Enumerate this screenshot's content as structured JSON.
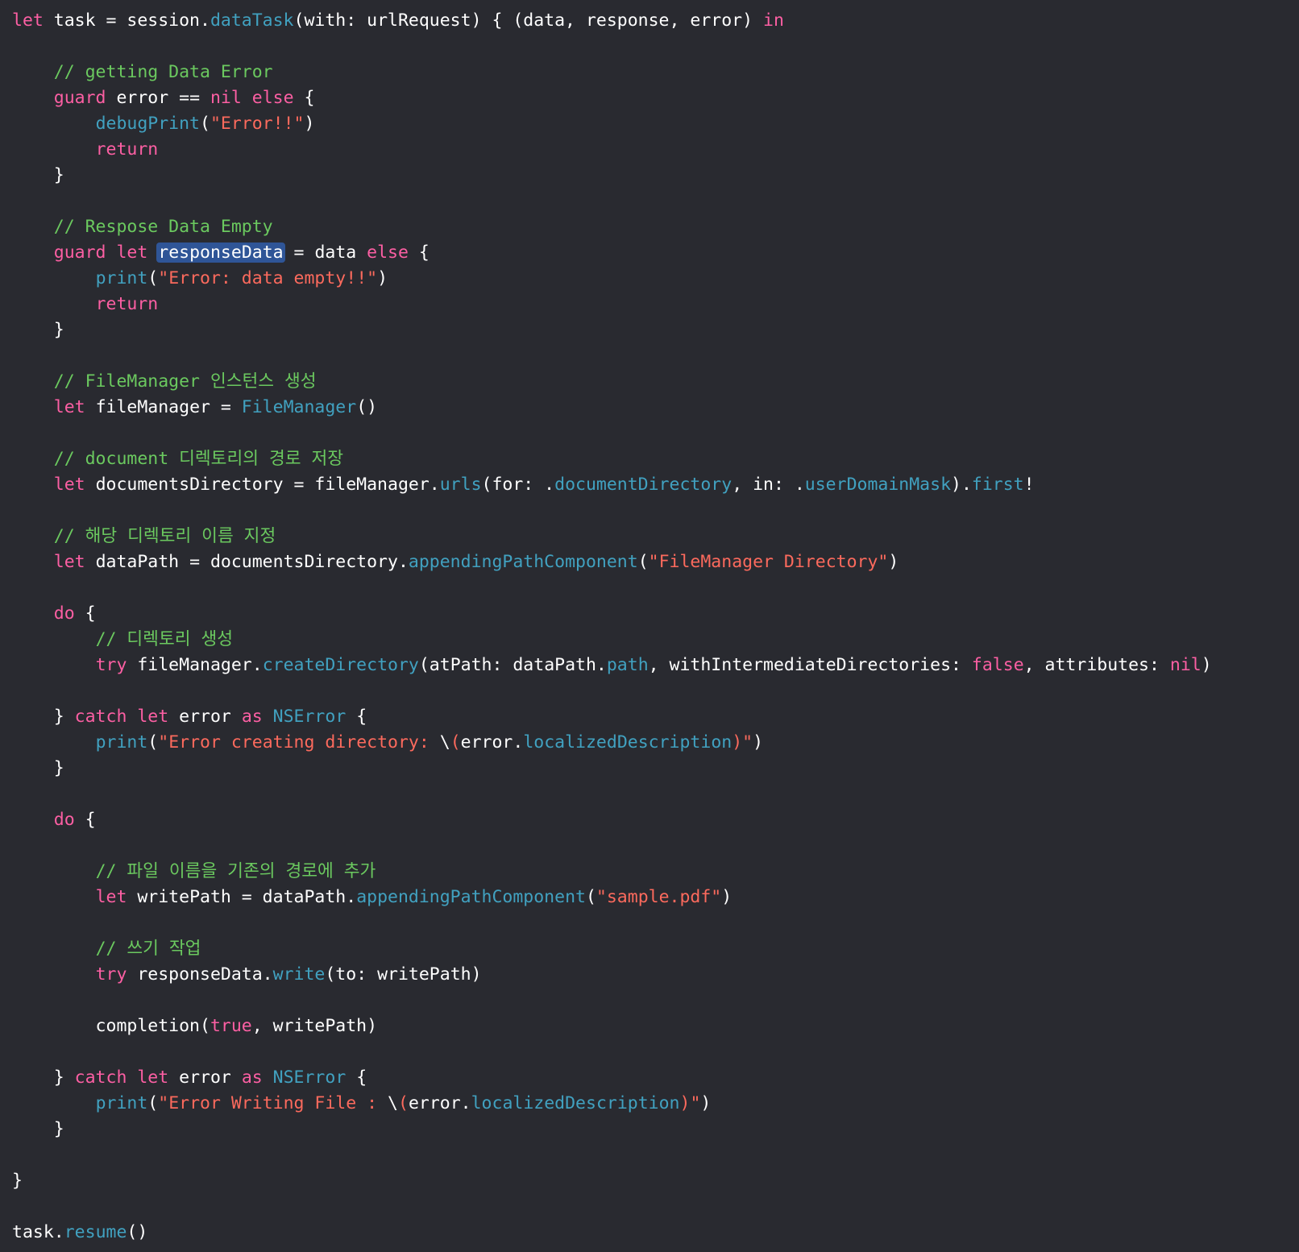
{
  "editor": {
    "theme_colors": {
      "background": "#292a30",
      "plain": "#ffffff",
      "keyword": "#fc5fa3",
      "comment": "#6bc95f",
      "string": "#fc6a5d",
      "function": "#41a1c0",
      "selection": "#2f5597"
    },
    "selected_token": "responseData",
    "lines": [
      [
        {
          "t": "kw",
          "v": "let"
        },
        {
          "t": "plain",
          "v": " task = session."
        },
        {
          "t": "fn",
          "v": "dataTask"
        },
        {
          "t": "plain",
          "v": "(with: urlRequest) { (data, response, error) "
        },
        {
          "t": "kw",
          "v": "in"
        }
      ],
      [],
      [
        {
          "t": "plain",
          "v": "    "
        },
        {
          "t": "com",
          "v": "// getting Data Error"
        }
      ],
      [
        {
          "t": "plain",
          "v": "    "
        },
        {
          "t": "kw",
          "v": "guard"
        },
        {
          "t": "plain",
          "v": " error == "
        },
        {
          "t": "kw",
          "v": "nil"
        },
        {
          "t": "plain",
          "v": " "
        },
        {
          "t": "kw",
          "v": "else"
        },
        {
          "t": "plain",
          "v": " {"
        }
      ],
      [
        {
          "t": "plain",
          "v": "        "
        },
        {
          "t": "fn",
          "v": "debugPrint"
        },
        {
          "t": "plain",
          "v": "("
        },
        {
          "t": "str",
          "v": "\"Error!!\""
        },
        {
          "t": "plain",
          "v": ")"
        }
      ],
      [
        {
          "t": "plain",
          "v": "        "
        },
        {
          "t": "kw",
          "v": "return"
        }
      ],
      [
        {
          "t": "plain",
          "v": "    }"
        }
      ],
      [],
      [
        {
          "t": "plain",
          "v": "    "
        },
        {
          "t": "com",
          "v": "// Respose Data Empty"
        }
      ],
      [
        {
          "t": "plain",
          "v": "    "
        },
        {
          "t": "kw",
          "v": "guard"
        },
        {
          "t": "plain",
          "v": " "
        },
        {
          "t": "kw",
          "v": "let"
        },
        {
          "t": "plain",
          "v": " "
        },
        {
          "t": "sel",
          "v": "responseData"
        },
        {
          "t": "plain",
          "v": " = data "
        },
        {
          "t": "kw",
          "v": "else"
        },
        {
          "t": "plain",
          "v": " {"
        }
      ],
      [
        {
          "t": "plain",
          "v": "        "
        },
        {
          "t": "fn",
          "v": "print"
        },
        {
          "t": "plain",
          "v": "("
        },
        {
          "t": "str",
          "v": "\"Error: data empty!!\""
        },
        {
          "t": "plain",
          "v": ")"
        }
      ],
      [
        {
          "t": "plain",
          "v": "        "
        },
        {
          "t": "kw",
          "v": "return"
        }
      ],
      [
        {
          "t": "plain",
          "v": "    }"
        }
      ],
      [],
      [
        {
          "t": "plain",
          "v": "    "
        },
        {
          "t": "com",
          "v": "// FileManager 인스턴스 생성"
        }
      ],
      [
        {
          "t": "plain",
          "v": "    "
        },
        {
          "t": "kw",
          "v": "let"
        },
        {
          "t": "plain",
          "v": " fileManager = "
        },
        {
          "t": "fn",
          "v": "FileManager"
        },
        {
          "t": "plain",
          "v": "()"
        }
      ],
      [],
      [
        {
          "t": "plain",
          "v": "    "
        },
        {
          "t": "com",
          "v": "// document 디렉토리의 경로 저장"
        }
      ],
      [
        {
          "t": "plain",
          "v": "    "
        },
        {
          "t": "kw",
          "v": "let"
        },
        {
          "t": "plain",
          "v": " documentsDirectory = fileManager."
        },
        {
          "t": "fn",
          "v": "urls"
        },
        {
          "t": "plain",
          "v": "(for: ."
        },
        {
          "t": "fn",
          "v": "documentDirectory"
        },
        {
          "t": "plain",
          "v": ", in: ."
        },
        {
          "t": "fn",
          "v": "userDomainMask"
        },
        {
          "t": "plain",
          "v": ")."
        },
        {
          "t": "fn",
          "v": "first"
        },
        {
          "t": "plain",
          "v": "!"
        }
      ],
      [],
      [
        {
          "t": "plain",
          "v": "    "
        },
        {
          "t": "com",
          "v": "// 해당 디렉토리 이름 지정"
        }
      ],
      [
        {
          "t": "plain",
          "v": "    "
        },
        {
          "t": "kw",
          "v": "let"
        },
        {
          "t": "plain",
          "v": " dataPath = documentsDirectory."
        },
        {
          "t": "fn",
          "v": "appendingPathComponent"
        },
        {
          "t": "plain",
          "v": "("
        },
        {
          "t": "str",
          "v": "\"FileManager Directory\""
        },
        {
          "t": "plain",
          "v": ")"
        }
      ],
      [],
      [
        {
          "t": "plain",
          "v": "    "
        },
        {
          "t": "kw",
          "v": "do"
        },
        {
          "t": "plain",
          "v": " {"
        }
      ],
      [
        {
          "t": "plain",
          "v": "        "
        },
        {
          "t": "com",
          "v": "// 디렉토리 생성"
        }
      ],
      [
        {
          "t": "plain",
          "v": "        "
        },
        {
          "t": "kw",
          "v": "try"
        },
        {
          "t": "plain",
          "v": " fileManager."
        },
        {
          "t": "fn",
          "v": "createDirectory"
        },
        {
          "t": "plain",
          "v": "(atPath: dataPath."
        },
        {
          "t": "fn",
          "v": "path"
        },
        {
          "t": "plain",
          "v": ", withIntermediateDirectories: "
        },
        {
          "t": "kw",
          "v": "false"
        },
        {
          "t": "plain",
          "v": ", attributes: "
        },
        {
          "t": "kw",
          "v": "nil"
        },
        {
          "t": "plain",
          "v": ")"
        }
      ],
      [],
      [
        {
          "t": "plain",
          "v": "    } "
        },
        {
          "t": "kw",
          "v": "catch"
        },
        {
          "t": "plain",
          "v": " "
        },
        {
          "t": "kw",
          "v": "let"
        },
        {
          "t": "plain",
          "v": " error "
        },
        {
          "t": "kw",
          "v": "as"
        },
        {
          "t": "plain",
          "v": " "
        },
        {
          "t": "fn",
          "v": "NSError"
        },
        {
          "t": "plain",
          "v": " {"
        }
      ],
      [
        {
          "t": "plain",
          "v": "        "
        },
        {
          "t": "fn",
          "v": "print"
        },
        {
          "t": "plain",
          "v": "("
        },
        {
          "t": "str",
          "v": "\"Error creating directory: "
        },
        {
          "t": "plain",
          "v": "\\"
        },
        {
          "t": "str",
          "v": "("
        },
        {
          "t": "plain",
          "v": "error."
        },
        {
          "t": "fn",
          "v": "localizedDescription"
        },
        {
          "t": "str",
          "v": ")\""
        },
        {
          "t": "plain",
          "v": ")"
        }
      ],
      [
        {
          "t": "plain",
          "v": "    }"
        }
      ],
      [],
      [
        {
          "t": "plain",
          "v": "    "
        },
        {
          "t": "kw",
          "v": "do"
        },
        {
          "t": "plain",
          "v": " {"
        }
      ],
      [],
      [
        {
          "t": "plain",
          "v": "        "
        },
        {
          "t": "com",
          "v": "// 파일 이름을 기존의 경로에 추가"
        }
      ],
      [
        {
          "t": "plain",
          "v": "        "
        },
        {
          "t": "kw",
          "v": "let"
        },
        {
          "t": "plain",
          "v": " writePath = dataPath."
        },
        {
          "t": "fn",
          "v": "appendingPathComponent"
        },
        {
          "t": "plain",
          "v": "("
        },
        {
          "t": "str",
          "v": "\"sample.pdf\""
        },
        {
          "t": "plain",
          "v": ")"
        }
      ],
      [],
      [
        {
          "t": "plain",
          "v": "        "
        },
        {
          "t": "com",
          "v": "// 쓰기 작업"
        }
      ],
      [
        {
          "t": "plain",
          "v": "        "
        },
        {
          "t": "kw",
          "v": "try"
        },
        {
          "t": "plain",
          "v": " responseData."
        },
        {
          "t": "fn",
          "v": "write"
        },
        {
          "t": "plain",
          "v": "(to: writePath)"
        }
      ],
      [],
      [
        {
          "t": "plain",
          "v": "        completion("
        },
        {
          "t": "kw",
          "v": "true"
        },
        {
          "t": "plain",
          "v": ", writePath)"
        }
      ],
      [],
      [
        {
          "t": "plain",
          "v": "    } "
        },
        {
          "t": "kw",
          "v": "catch"
        },
        {
          "t": "plain",
          "v": " "
        },
        {
          "t": "kw",
          "v": "let"
        },
        {
          "t": "plain",
          "v": " error "
        },
        {
          "t": "kw",
          "v": "as"
        },
        {
          "t": "plain",
          "v": " "
        },
        {
          "t": "fn",
          "v": "NSError"
        },
        {
          "t": "plain",
          "v": " {"
        }
      ],
      [
        {
          "t": "plain",
          "v": "        "
        },
        {
          "t": "fn",
          "v": "print"
        },
        {
          "t": "plain",
          "v": "("
        },
        {
          "t": "str",
          "v": "\"Error Writing File : "
        },
        {
          "t": "plain",
          "v": "\\"
        },
        {
          "t": "str",
          "v": "("
        },
        {
          "t": "plain",
          "v": "error."
        },
        {
          "t": "fn",
          "v": "localizedDescription"
        },
        {
          "t": "str",
          "v": ")\""
        },
        {
          "t": "plain",
          "v": ")"
        }
      ],
      [
        {
          "t": "plain",
          "v": "    }"
        }
      ],
      [],
      [
        {
          "t": "plain",
          "v": "}"
        }
      ],
      [],
      [
        {
          "t": "plain",
          "v": "task."
        },
        {
          "t": "fn",
          "v": "resume"
        },
        {
          "t": "plain",
          "v": "()"
        }
      ]
    ]
  }
}
